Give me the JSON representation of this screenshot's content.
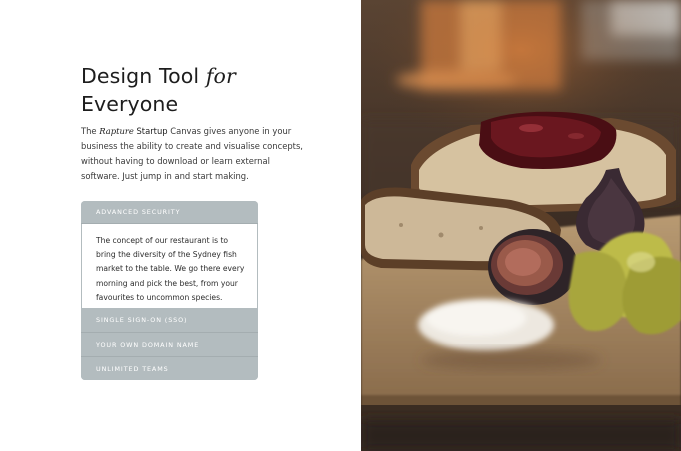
{
  "hero": {
    "title_main": "Design Tool ",
    "title_em": "for",
    "title_line2": "Everyone",
    "intro_prefix": "The ",
    "intro_brand_em": "Rapture",
    "intro_brand_strong": " Startup",
    "intro_text": " Canvas gives anyone in your business the ability to create and visualise concepts, without having to download or learn external software. Just jump in and start making."
  },
  "accordion": {
    "open_title": "ADVANCED SECURITY",
    "open_body": "The concept of our restaurant is to bring the diversity of the Sydney fish market to the table. We go there every morning and pick the best, from your favourites to uncommon species.",
    "items": [
      {
        "label": "SINGLE SIGN-ON (SSO)"
      },
      {
        "label": "YOUR OWN DOMAIN NAME"
      },
      {
        "label": "UNLIMITED TEAMS"
      }
    ]
  },
  "colors": {
    "accordion_bg": "#b3bcbf",
    "heading": "#1d1d1d",
    "body_text": "#3a3a3a"
  }
}
